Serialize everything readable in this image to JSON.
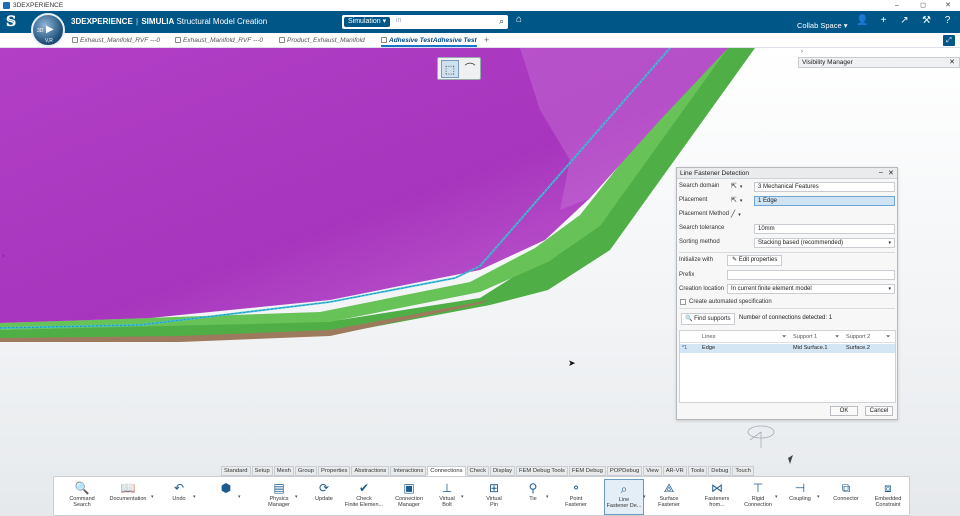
{
  "os_bar": {
    "title": "3DEXPERIENCE",
    "minimize": "–",
    "maximize": "◻",
    "close": "✕"
  },
  "header": {
    "logo": "𝕊",
    "compass_3d": "3D",
    "compass_play": "▶",
    "compass_version": "V,R",
    "brand": "3DEXPERIENCE",
    "separator": "|",
    "product": "SIMULIA",
    "app": "Structural Model Creation",
    "search_scope": "Simulation ▾",
    "search_placeholder": "",
    "search_caret": "in",
    "collab_space": "Collab Space ▾",
    "icons": {
      "user": "👤",
      "plus": "+",
      "share": "↗",
      "tools": "⚒",
      "help": "?"
    }
  },
  "tabs": [
    {
      "label": "Exhaust_Manifold_RVF ---0",
      "active": false
    },
    {
      "label": "Exhaust_Manifold_RVF ---0",
      "active": false
    },
    {
      "label": "Product_Exhaust_Manifold",
      "active": false
    },
    {
      "label": "Adhesive TestAdhesive Test",
      "active": true
    }
  ],
  "tab_plus": "+",
  "expand": "⤢",
  "visibility_manager": {
    "arrow": "›",
    "title": "Visibility Manager",
    "close": "✕"
  },
  "selection_toolbar": {
    "select_icon": "⬚",
    "trap_icon": "⌒"
  },
  "dialog": {
    "title": "Line Fastener Detection",
    "minimize": "–",
    "close": "✕",
    "search_domain_label": "Search domain",
    "search_domain_value": "3 Mechanical Features",
    "placement_label": "Placement",
    "placement_value": "1 Edge",
    "placement_method_label": "Placement Method",
    "search_tolerance_label": "Search tolerance",
    "search_tolerance_value": "10mm",
    "sorting_method_label": "Sorting method",
    "sorting_method_value": "Stacking based (recommended)",
    "initialize_with_label": "Initialize with",
    "edit_properties": "✎ Edit properties",
    "prefix_label": "Prefix",
    "prefix_value": "",
    "creation_location_label": "Creation location",
    "creation_location_value": "In current finite element model",
    "create_automated_label": "Create automated specification",
    "find_supports": "🔍 Find supports",
    "connections_detected": "Number of connections detected: 1",
    "table": {
      "headers": [
        "Lines",
        "Support 1",
        "Support 2"
      ],
      "rows": [
        {
          "marker": "*1",
          "lines": "Edge",
          "support1": "Mid Surface.1",
          "support2": "Surface.2"
        }
      ]
    },
    "ok": "OK",
    "cancel": "Cancel"
  },
  "bottom_tabs": [
    "Standard",
    "Setup",
    "Mesh",
    "Group",
    "Properties",
    "Abstractions",
    "Interactions",
    "Connections",
    "Check",
    "Display",
    "FEM Debug Tools",
    "FEM Debug",
    "POPDebug",
    "View",
    "AR-VR",
    "Tools",
    "Debug",
    "Touch"
  ],
  "bottom_tab_active": "Connections",
  "action_bar": [
    {
      "label": "Command\nSearch",
      "icon": "🔍"
    },
    {
      "label": "Documentation",
      "icon": "📖"
    },
    {
      "label": "Undo",
      "icon": "↶"
    },
    {
      "label": "",
      "icon": "⬢"
    },
    {
      "label": "Physics\nManager",
      "icon": "▤"
    },
    {
      "label": "Update",
      "icon": "⟳"
    },
    {
      "label": "Check\nFinite Elemen...",
      "icon": "✔"
    },
    {
      "label": "Connection\nManager",
      "icon": "▣"
    },
    {
      "label": "Virtual\nBolt",
      "icon": "⊥"
    },
    {
      "label": "Virtual\nPin",
      "icon": "⊞"
    },
    {
      "label": "Tie",
      "icon": "⚲"
    },
    {
      "label": "Point\nFastener",
      "icon": "⚬"
    },
    {
      "label": "Line\nFastener De...",
      "icon": "⌕"
    },
    {
      "label": "Surface\nFastener",
      "icon": "⟁"
    },
    {
      "label": "Fasteners\nfrom...",
      "icon": "⋈"
    },
    {
      "label": "Rigid\nConnection",
      "icon": "⊤"
    },
    {
      "label": "Coupling",
      "icon": "⊣"
    },
    {
      "label": "Connector",
      "icon": "⧉"
    },
    {
      "label": "Embedded\nConstraint",
      "icon": "⧈"
    }
  ],
  "colors": {
    "header_blue": "#005686",
    "magenta_part": "#b13cc4",
    "green_part": "#55b148",
    "bar_selected": "#e4eef7"
  }
}
